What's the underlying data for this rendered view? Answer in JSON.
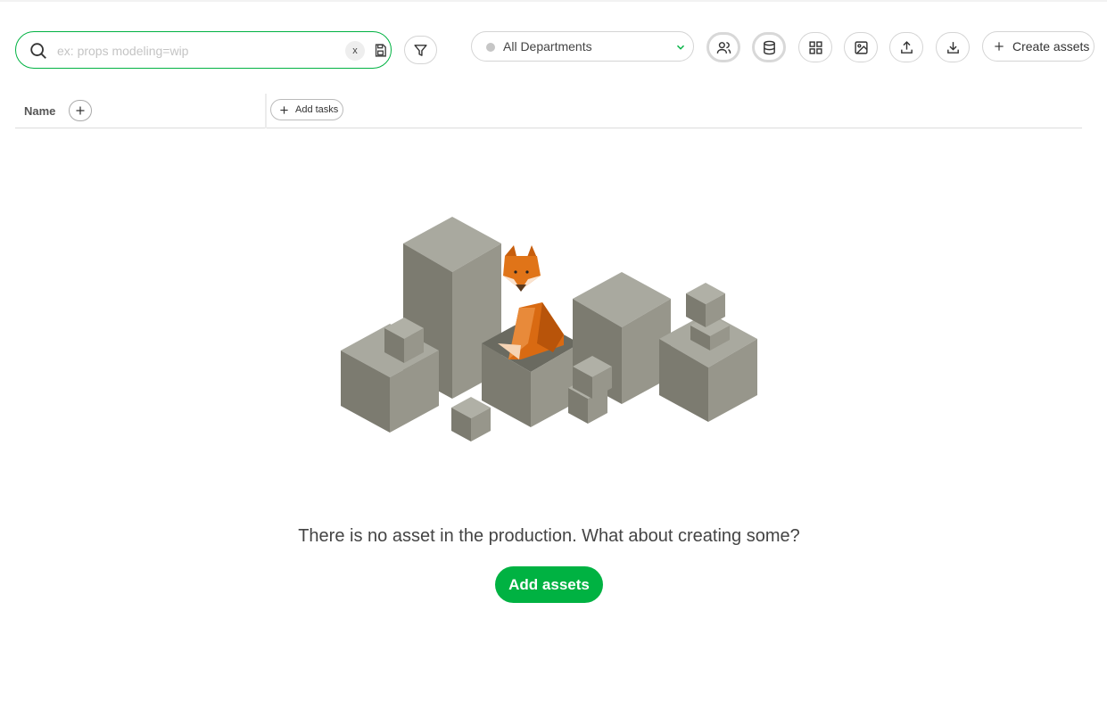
{
  "search": {
    "placeholder": "ex: props modeling=wip",
    "clear_label": "x"
  },
  "toolbar": {
    "department_selected": "All Departments",
    "create_label": "Create assets"
  },
  "table": {
    "name_header": "Name",
    "add_tasks_label": "Add tasks"
  },
  "empty_state": {
    "message": "There is no asset in the production. What about creating some?",
    "button_label": "Add assets"
  },
  "colors": {
    "accent": "#00b242",
    "box_light": "#a9a9a0",
    "box_dark": "#7a7a70",
    "fox": "#d96a12"
  }
}
